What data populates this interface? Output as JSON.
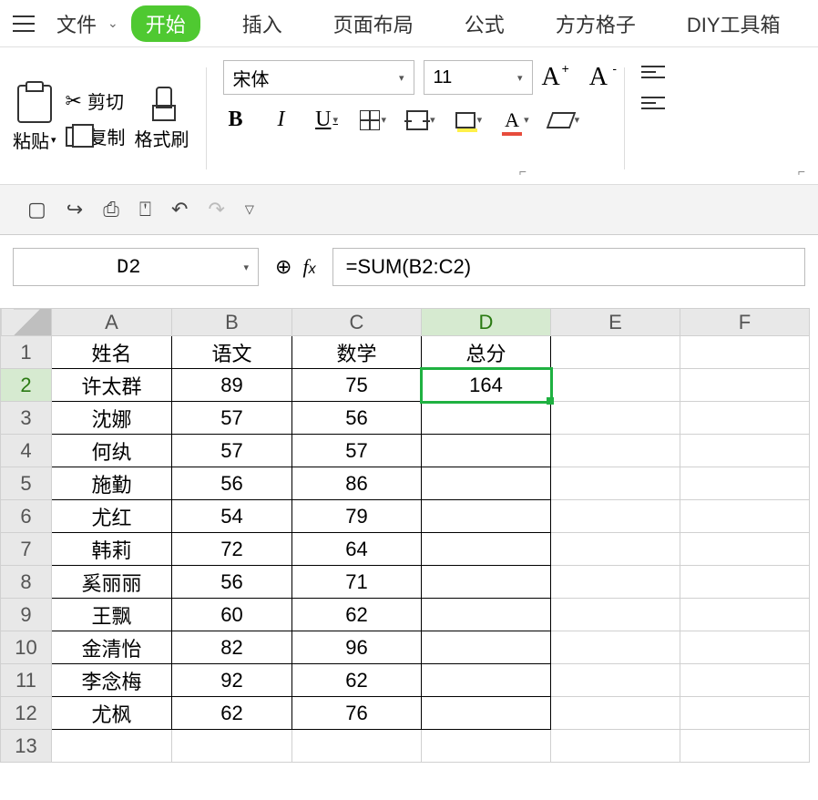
{
  "menu": {
    "file": "文件",
    "start": "开始",
    "insert": "插入",
    "layout": "页面布局",
    "formula": "公式",
    "fangfang": "方方格子",
    "diy": "DIY工具箱"
  },
  "ribbon": {
    "paste": "粘贴",
    "cut": "剪切",
    "copy": "复制",
    "format_painter": "格式刷",
    "font_name": "宋体",
    "font_size": "11"
  },
  "formula_bar": {
    "cell_ref": "D2",
    "formula": "=SUM(B2:C2)"
  },
  "columns": [
    "A",
    "B",
    "C",
    "D",
    "E",
    "F"
  ],
  "headers": [
    "姓名",
    "语文",
    "数学",
    "总分"
  ],
  "rows": [
    {
      "n": "1",
      "a": "姓名",
      "b": "语文",
      "c": "数学",
      "d": "总分"
    },
    {
      "n": "2",
      "a": "许太群",
      "b": "89",
      "c": "75",
      "d": "164"
    },
    {
      "n": "3",
      "a": "沈娜",
      "b": "57",
      "c": "56",
      "d": ""
    },
    {
      "n": "4",
      "a": "何纨",
      "b": "57",
      "c": "57",
      "d": ""
    },
    {
      "n": "5",
      "a": "施勤",
      "b": "56",
      "c": "86",
      "d": ""
    },
    {
      "n": "6",
      "a": "尤红",
      "b": "54",
      "c": "79",
      "d": ""
    },
    {
      "n": "7",
      "a": "韩莉",
      "b": "72",
      "c": "64",
      "d": ""
    },
    {
      "n": "8",
      "a": "奚丽丽",
      "b": "56",
      "c": "71",
      "d": ""
    },
    {
      "n": "9",
      "a": "王飘",
      "b": "60",
      "c": "62",
      "d": ""
    },
    {
      "n": "10",
      "a": "金清怡",
      "b": "82",
      "c": "96",
      "d": ""
    },
    {
      "n": "11",
      "a": "李念梅",
      "b": "92",
      "c": "62",
      "d": ""
    },
    {
      "n": "12",
      "a": "尤枫",
      "b": "62",
      "c": "76",
      "d": ""
    },
    {
      "n": "13",
      "a": "",
      "b": "",
      "c": "",
      "d": ""
    }
  ],
  "selected": {
    "row": "2",
    "col": "D"
  }
}
